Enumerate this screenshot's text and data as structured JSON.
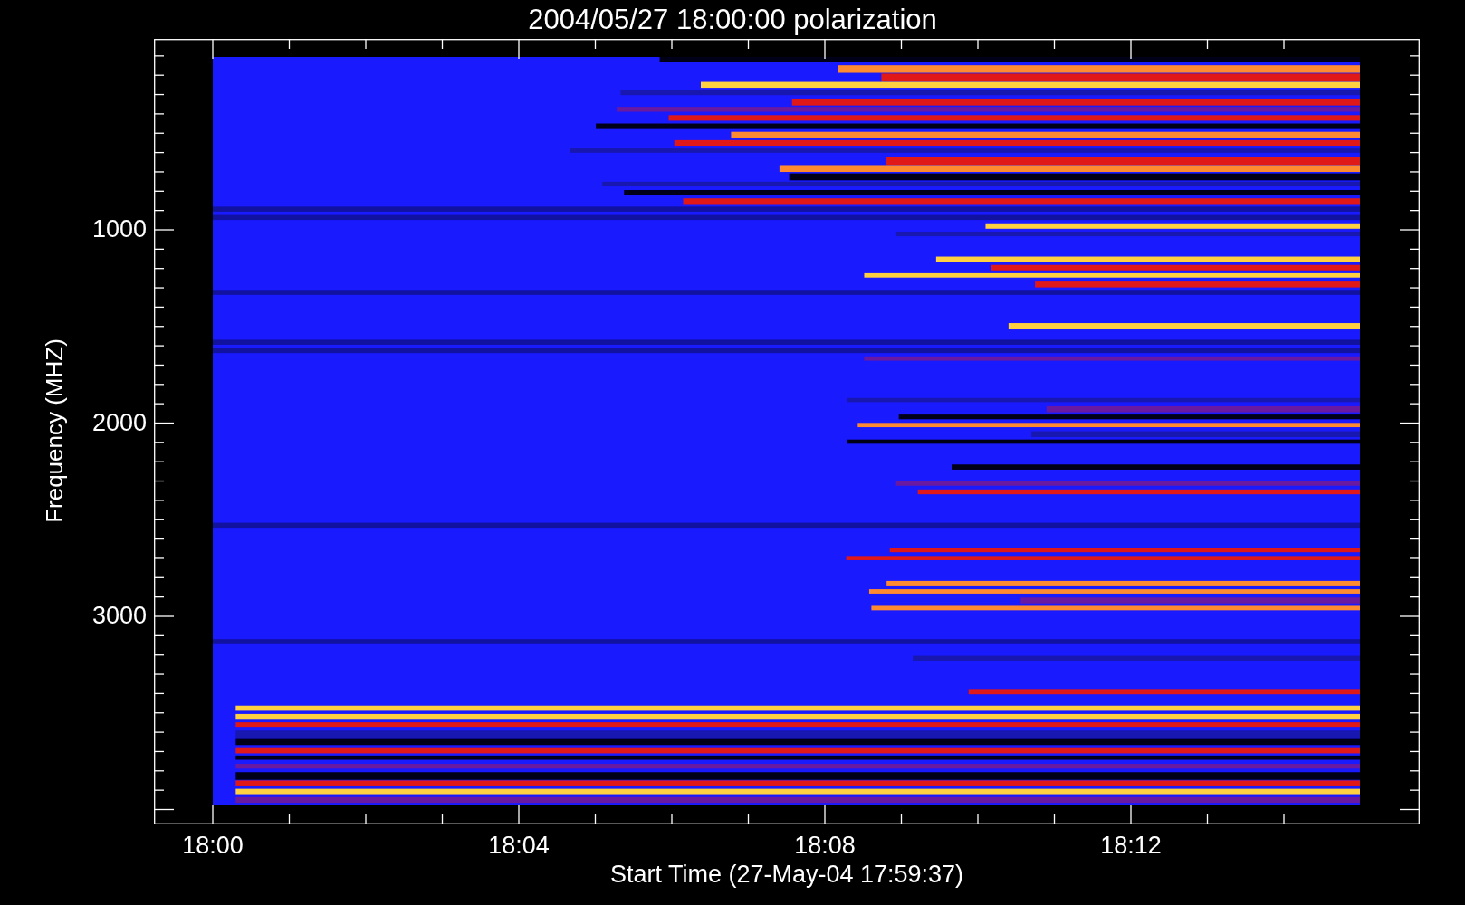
{
  "title": "2004/05/27 18:00:00 polarization",
  "y_axis": {
    "label": "Frequency (MHZ)",
    "ticks": [
      "1000",
      "2000",
      "3000"
    ]
  },
  "x_axis": {
    "label": "Start Time (27-May-04 17:59:37)",
    "ticks": [
      "18:00",
      "18:04",
      "18:08",
      "18:12"
    ]
  }
}
